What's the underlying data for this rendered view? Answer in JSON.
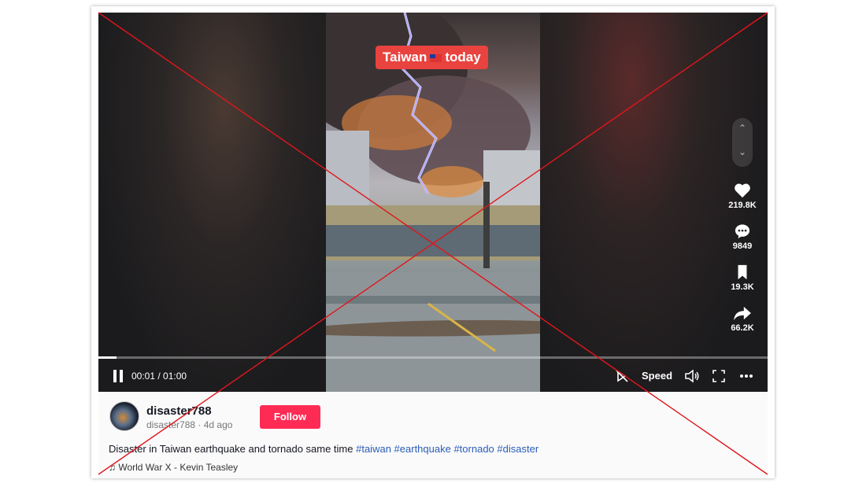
{
  "video": {
    "overlay_caption_before": "Taiwan",
    "overlay_caption_after": "today",
    "time_current": "00:01",
    "time_separator": " / ",
    "time_total": "01:00",
    "progress_fraction": 0.027
  },
  "actions": {
    "likes": "219.8K",
    "comments": "9849",
    "saves": "19.3K",
    "shares": "66.2K"
  },
  "controls": {
    "speed_label": "Speed"
  },
  "post": {
    "username": "disaster788",
    "handle": "disaster788",
    "separator": " · ",
    "posted": "4d ago",
    "follow_label": "Follow",
    "description": "Disaster in Taiwan earthquake and tornado same time ",
    "hashtags": [
      "#taiwan",
      "#earthquake",
      "#tornado",
      "#disaster"
    ],
    "music": "World War X - Kevin Teasley"
  },
  "colors": {
    "follow_button": "#fe2c55",
    "caption_badge": "#e8433f",
    "hashtag": "#2b5db8",
    "cross_lines": "#e0161c"
  },
  "icons": [
    "pause-icon",
    "heart-icon",
    "comment-icon",
    "bookmark-icon",
    "share-icon",
    "chevron-up-icon",
    "chevron-down-icon",
    "speed-icon",
    "volume-icon",
    "fullscreen-icon",
    "more-icon",
    "music-note-icon"
  ]
}
